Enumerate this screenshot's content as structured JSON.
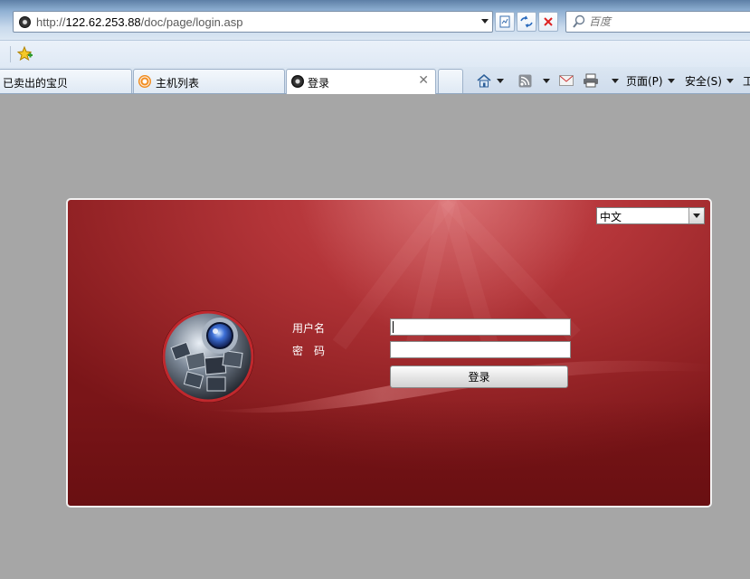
{
  "browser": {
    "address": {
      "prefix": "http://",
      "host": "122.62.253.88",
      "path": "/doc/page/login.asp"
    },
    "search": {
      "placeholder": "百度"
    },
    "tabs": [
      {
        "label": "已卖出的宝贝"
      },
      {
        "label": "主机列表"
      },
      {
        "label": "登录",
        "active": true
      }
    ],
    "commands": {
      "page_label": "页面(P)",
      "safety_label": "安全(S)",
      "tools_label": "工"
    }
  },
  "login": {
    "language": {
      "selected": "中文"
    },
    "username_label": "用户名",
    "password_label": "密　码",
    "username_value": "",
    "password_value": "",
    "submit_label": "登录"
  },
  "colors": {
    "panel_red": "#9a2629",
    "page_gray": "#a6a6a6",
    "chrome_blue": "#dbe6f2"
  }
}
